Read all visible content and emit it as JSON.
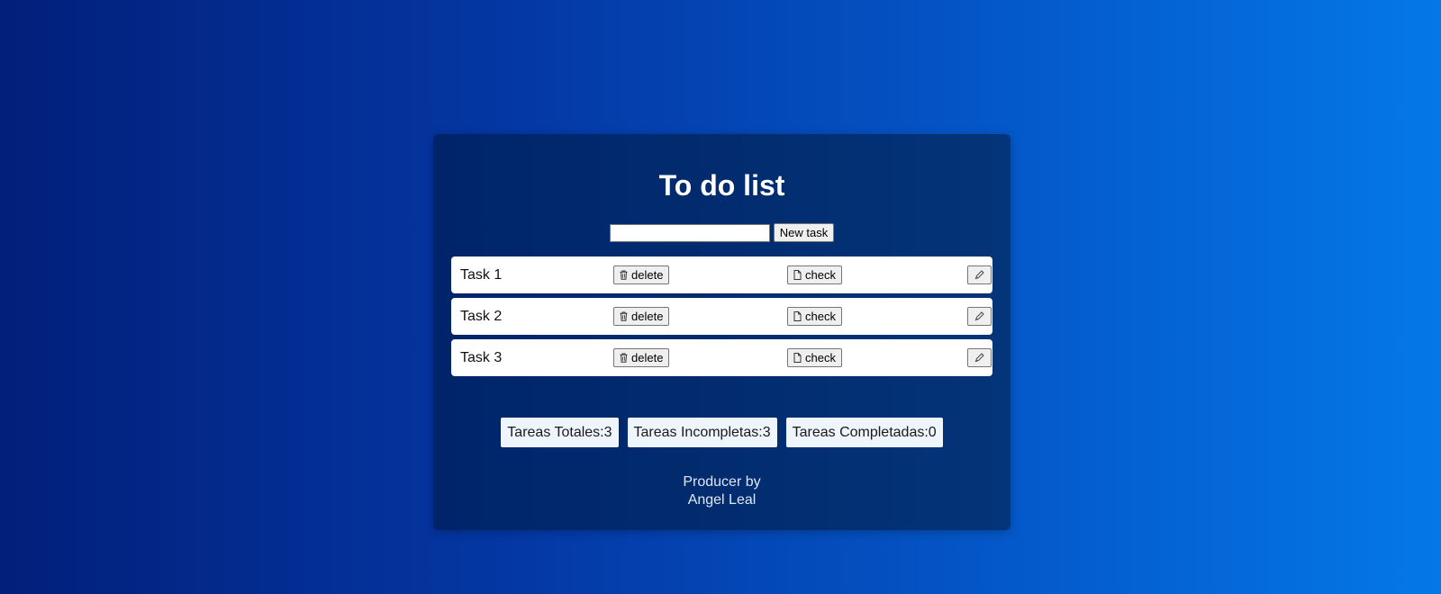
{
  "app": {
    "title": "To do list"
  },
  "new_task": {
    "input_value": "",
    "input_placeholder": "",
    "button_label": "New task"
  },
  "tasks": [
    {
      "label": "Task 1",
      "delete_label": "delete",
      "check_label": "check"
    },
    {
      "label": "Task 2",
      "delete_label": "delete",
      "check_label": "check"
    },
    {
      "label": "Task 3",
      "delete_label": "delete",
      "check_label": "check"
    }
  ],
  "icons": {
    "delete": "trash-icon",
    "check": "document-icon",
    "edit": "pencil-icon"
  },
  "stats": {
    "total": "Tareas Totales:3",
    "incomplete": "Tareas Incompletas:3",
    "completed": "Tareas Completadas:0"
  },
  "footer": {
    "line1": "Producer by",
    "line2": "Angel Leal"
  },
  "colors": {
    "background_left": "#021f7a",
    "background_right": "#0478e8",
    "card": "#022c6f",
    "stat_bg": "#eef5fd"
  }
}
